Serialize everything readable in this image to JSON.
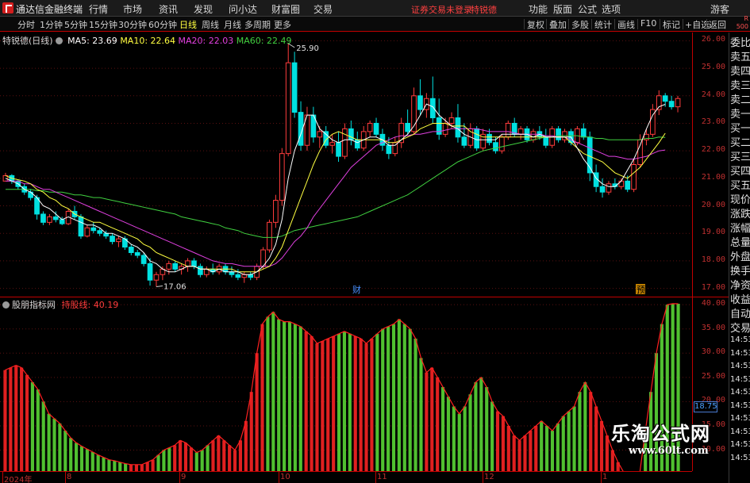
{
  "app": {
    "title": "通达信金融终端"
  },
  "menu": [
    "行情",
    "市场",
    "资讯",
    "发现",
    "问小达",
    "财富圈",
    "交易"
  ],
  "status": {
    "login": "证券交易未登录",
    "stock": "特锐德"
  },
  "right_menu": [
    "功能",
    "版面",
    "公式",
    "选项"
  ],
  "guest": "游客",
  "periods": [
    "分时",
    "1分钟",
    "5分钟",
    "15分钟",
    "30分钟",
    "60分钟",
    "日线",
    "周线",
    "月线",
    "多周期",
    "更多"
  ],
  "active_period": "日线",
  "toolbar_right": [
    "复权",
    "叠加",
    "多股",
    "统计",
    "画线",
    "F10",
    "标记",
    "+自选",
    "返回"
  ],
  "rs_badge": {
    "top": "R",
    "bottom": "500"
  },
  "stock_label": "特锐德(日线)",
  "ma": [
    {
      "label": "MA5: 23.69",
      "color": "#ffffff"
    },
    {
      "label": "MA10: 22.64",
      "color": "#ffff40"
    },
    {
      "label": "MA20: 22.03",
      "color": "#e040e0"
    },
    {
      "label": "MA60: 22.49",
      "color": "#40d040"
    }
  ],
  "price_axis": [
    "26.00",
    "25.00",
    "24.00",
    "23.00",
    "22.00",
    "21.00",
    "20.00",
    "19.00",
    "18.00",
    "17.00"
  ],
  "annotations": {
    "high": "25.90",
    "low": "17.06",
    "cai": "财",
    "yu": "预"
  },
  "indicator": {
    "name": "股朋指标网",
    "line_name": "持股线",
    "line_value": "40.19",
    "current": "18.75"
  },
  "indicator_axis": [
    "40.00",
    "35.00",
    "30.00",
    "25.00",
    "20.00",
    "15.00",
    "10.00"
  ],
  "dates": [
    "2024年",
    "8",
    "9",
    "10",
    "11",
    "12",
    "1"
  ],
  "side_panel": [
    "委比",
    "卖五",
    "卖四",
    "卖三",
    "卖二",
    "卖一",
    "买一",
    "买二",
    "买三",
    "买四",
    "买五",
    "现价",
    "涨跌",
    "涨幅",
    "总量",
    "外盘",
    "换手",
    "净资",
    "收益",
    "自动",
    "交易"
  ],
  "side_times": [
    "14:53",
    "14:53",
    "14:53",
    "14:53",
    "14:53",
    "14:53",
    "14:53",
    "14:53",
    "14:53",
    "14:53"
  ],
  "watermark": {
    "line1": "乐淘公式网",
    "line2": "www.60lt.com"
  },
  "colors": {
    "up": "#ff3c3c",
    "down": "#00e0e0",
    "ind_up": "#e02020",
    "ind_down": "#50c030",
    "frame": "#c00000"
  },
  "chart_data": {
    "type": "candlestick",
    "price_range": [
      16.7,
      26.3
    ],
    "candles": [
      [
        20.9,
        21.2,
        21.0,
        21.1
      ],
      [
        21.1,
        21.15,
        20.8,
        20.9
      ],
      [
        20.9,
        20.95,
        20.6,
        20.7
      ],
      [
        20.7,
        20.8,
        20.4,
        20.5
      ],
      [
        20.5,
        20.6,
        20.2,
        20.3
      ],
      [
        20.3,
        20.4,
        19.5,
        19.7
      ],
      [
        19.7,
        19.8,
        19.3,
        19.4
      ],
      [
        19.4,
        19.7,
        19.3,
        19.6
      ],
      [
        19.6,
        19.8,
        19.4,
        19.5
      ],
      [
        19.5,
        19.6,
        19.3,
        19.35
      ],
      [
        19.35,
        19.9,
        19.3,
        19.8
      ],
      [
        19.8,
        20.0,
        19.5,
        19.6
      ],
      [
        19.6,
        19.7,
        18.8,
        18.9
      ],
      [
        18.9,
        19.3,
        18.85,
        19.2
      ],
      [
        19.2,
        19.4,
        19.0,
        19.1
      ],
      [
        19.1,
        19.2,
        18.9,
        19.0
      ],
      [
        19.0,
        19.1,
        18.8,
        18.9
      ],
      [
        18.9,
        19.0,
        18.6,
        18.7
      ],
      [
        18.7,
        18.9,
        18.5,
        18.8
      ],
      [
        18.8,
        18.9,
        18.4,
        18.5
      ],
      [
        18.5,
        18.6,
        18.2,
        18.3
      ],
      [
        18.3,
        18.4,
        18.1,
        18.2
      ],
      [
        18.2,
        18.3,
        17.8,
        17.9
      ],
      [
        17.9,
        18.1,
        17.1,
        17.3
      ],
      [
        17.3,
        17.6,
        17.06,
        17.5
      ],
      [
        17.5,
        17.8,
        17.3,
        17.7
      ],
      [
        17.7,
        18.0,
        17.5,
        17.9
      ],
      [
        17.9,
        18.0,
        17.6,
        17.7
      ],
      [
        17.7,
        17.9,
        17.5,
        17.8
      ],
      [
        17.8,
        18.1,
        17.6,
        18.0
      ],
      [
        18.0,
        18.1,
        17.7,
        17.8
      ],
      [
        17.8,
        17.9,
        17.4,
        17.5
      ],
      [
        17.5,
        17.8,
        17.4,
        17.7
      ],
      [
        17.7,
        17.9,
        17.5,
        17.6
      ],
      [
        17.6,
        17.9,
        17.5,
        17.8
      ],
      [
        17.8,
        17.9,
        17.5,
        17.6
      ],
      [
        17.6,
        17.8,
        17.4,
        17.5
      ],
      [
        17.5,
        17.7,
        17.3,
        17.4
      ],
      [
        17.4,
        17.6,
        17.2,
        17.5
      ],
      [
        17.5,
        17.6,
        17.3,
        17.4
      ],
      [
        17.4,
        17.9,
        17.3,
        17.8
      ],
      [
        17.8,
        18.5,
        17.7,
        18.4
      ],
      [
        18.4,
        19.5,
        18.3,
        19.4
      ],
      [
        19.4,
        20.4,
        19.2,
        20.2
      ],
      [
        20.2,
        22.1,
        20.0,
        21.9
      ],
      [
        21.9,
        25.9,
        21.8,
        25.2
      ],
      [
        25.2,
        25.6,
        23.2,
        23.4
      ],
      [
        23.4,
        23.8,
        22.0,
        22.2
      ],
      [
        22.2,
        23.6,
        22.0,
        23.3
      ],
      [
        23.3,
        23.6,
        22.3,
        22.5
      ],
      [
        22.5,
        22.9,
        22.1,
        22.7
      ],
      [
        22.7,
        22.9,
        22.1,
        22.2
      ],
      [
        22.2,
        22.6,
        21.9,
        22.3
      ],
      [
        22.3,
        22.7,
        21.6,
        21.8
      ],
      [
        21.8,
        23.0,
        21.7,
        22.8
      ],
      [
        22.8,
        23.1,
        22.2,
        22.4
      ],
      [
        22.4,
        22.7,
        22.0,
        22.1
      ],
      [
        22.1,
        22.9,
        22.0,
        22.7
      ],
      [
        22.7,
        23.1,
        22.5,
        23.0
      ],
      [
        23.0,
        23.2,
        22.5,
        22.6
      ],
      [
        22.6,
        22.8,
        22.0,
        22.2
      ],
      [
        22.2,
        22.5,
        21.7,
        21.9
      ],
      [
        21.9,
        22.5,
        21.8,
        22.3
      ],
      [
        22.3,
        23.2,
        22.1,
        23.0
      ],
      [
        23.0,
        23.5,
        22.6,
        22.7
      ],
      [
        22.7,
        24.3,
        22.6,
        24.0
      ],
      [
        24.0,
        24.6,
        23.3,
        23.5
      ],
      [
        23.5,
        24.1,
        23.2,
        23.9
      ],
      [
        23.9,
        24.7,
        23.0,
        23.2
      ],
      [
        23.2,
        23.9,
        22.4,
        22.6
      ],
      [
        22.6,
        23.2,
        22.5,
        23.0
      ],
      [
        23.0,
        23.4,
        22.8,
        23.2
      ],
      [
        23.2,
        23.7,
        22.3,
        22.5
      ],
      [
        22.5,
        23.0,
        22.1,
        22.2
      ],
      [
        22.2,
        23.0,
        22.1,
        22.8
      ],
      [
        22.8,
        22.9,
        22.0,
        22.1
      ],
      [
        22.1,
        22.8,
        22.0,
        22.6
      ],
      [
        22.6,
        22.8,
        22.2,
        22.3
      ],
      [
        22.3,
        22.5,
        21.9,
        22.0
      ],
      [
        22.0,
        22.6,
        21.9,
        22.5
      ],
      [
        22.5,
        23.1,
        22.4,
        23.0
      ],
      [
        23.0,
        23.2,
        22.5,
        22.6
      ],
      [
        22.6,
        22.9,
        22.4,
        22.8
      ],
      [
        22.8,
        22.9,
        22.3,
        22.4
      ],
      [
        22.4,
        22.8,
        22.3,
        22.7
      ],
      [
        22.7,
        22.9,
        22.4,
        22.5
      ],
      [
        22.5,
        22.8,
        22.1,
        22.2
      ],
      [
        22.2,
        22.9,
        22.1,
        22.8
      ],
      [
        22.8,
        22.9,
        22.3,
        22.4
      ],
      [
        22.4,
        22.8,
        22.3,
        22.7
      ],
      [
        22.7,
        22.8,
        22.2,
        22.3
      ],
      [
        22.3,
        22.9,
        22.2,
        22.8
      ],
      [
        22.8,
        23.0,
        22.4,
        22.5
      ],
      [
        22.5,
        22.7,
        20.9,
        21.2
      ],
      [
        21.2,
        21.5,
        20.5,
        20.7
      ],
      [
        20.7,
        21.0,
        20.3,
        20.5
      ],
      [
        20.5,
        20.9,
        20.4,
        20.8
      ],
      [
        20.8,
        21.0,
        20.6,
        20.7
      ],
      [
        20.7,
        21.0,
        20.6,
        20.9
      ],
      [
        20.9,
        21.1,
        20.5,
        20.6
      ],
      [
        20.6,
        21.7,
        20.5,
        21.5
      ],
      [
        21.5,
        22.6,
        21.4,
        22.4
      ],
      [
        22.4,
        22.8,
        22.2,
        22.6
      ],
      [
        22.6,
        23.7,
        22.5,
        23.5
      ],
      [
        23.5,
        24.2,
        23.3,
        24.0
      ],
      [
        24.0,
        24.1,
        23.6,
        23.8
      ],
      [
        23.8,
        24.0,
        23.5,
        23.6
      ],
      [
        23.6,
        24.0,
        23.4,
        23.9
      ]
    ],
    "ma5": [
      21.0,
      20.9,
      20.8,
      20.6,
      20.5,
      20.3,
      20.0,
      19.9,
      19.7,
      19.5,
      19.6,
      19.5,
      19.4,
      19.3,
      19.3,
      19.2,
      19.0,
      19.0,
      18.9,
      18.8,
      18.6,
      18.5,
      18.3,
      18.0,
      17.9,
      17.7,
      17.6,
      17.6,
      17.7,
      17.8,
      17.8,
      17.7,
      17.7,
      17.6,
      17.7,
      17.6,
      17.6,
      17.6,
      17.5,
      17.5,
      17.6,
      17.8,
      18.1,
      18.6,
      19.5,
      21.0,
      22.0,
      22.6,
      23.3,
      23.3,
      22.8,
      22.6,
      22.4,
      22.3,
      22.4,
      22.4,
      22.3,
      22.4,
      22.5,
      22.5,
      22.4,
      22.2,
      22.2,
      22.4,
      22.6,
      22.9,
      23.3,
      23.7,
      23.6,
      23.3,
      23.1,
      22.9,
      22.8,
      22.6,
      22.5,
      22.4,
      22.4,
      22.4,
      22.4,
      22.6,
      22.6,
      22.6,
      22.6,
      22.6,
      22.5,
      22.6,
      22.5,
      22.5,
      22.5,
      22.5,
      22.5,
      22.1,
      21.7,
      21.4,
      21.0,
      20.8,
      20.7,
      20.7,
      20.9,
      21.3,
      21.7,
      22.2,
      22.8,
      23.3,
      23.6,
      23.69
    ],
    "ma10": [
      21.1,
      21.0,
      20.95,
      20.9,
      20.8,
      20.6,
      20.5,
      20.3,
      20.2,
      20.0,
      19.9,
      19.7,
      19.6,
      19.5,
      19.4,
      19.4,
      19.3,
      19.2,
      19.1,
      19.0,
      18.9,
      18.8,
      18.6,
      18.5,
      18.3,
      18.2,
      18.1,
      18.0,
      17.9,
      17.8,
      17.8,
      17.7,
      17.7,
      17.7,
      17.7,
      17.7,
      17.7,
      17.6,
      17.6,
      17.6,
      17.6,
      17.7,
      17.8,
      18.1,
      18.5,
      19.1,
      19.7,
      20.3,
      20.9,
      21.5,
      22.0,
      22.4,
      22.6,
      22.7,
      22.6,
      22.5,
      22.4,
      22.4,
      22.4,
      22.4,
      22.4,
      22.3,
      22.3,
      22.4,
      22.5,
      22.6,
      22.8,
      22.9,
      23.0,
      23.0,
      23.0,
      22.9,
      22.9,
      22.9,
      22.7,
      22.6,
      22.5,
      22.5,
      22.5,
      22.5,
      22.5,
      22.5,
      22.5,
      22.5,
      22.5,
      22.5,
      22.5,
      22.5,
      22.5,
      22.5,
      22.3,
      22.1,
      21.9,
      21.8,
      21.7,
      21.6,
      21.4,
      21.2,
      21.1,
      21.0,
      21.2,
      21.4,
      21.7,
      22.0,
      22.3,
      22.64
    ],
    "ma20": [
      20.9,
      20.9,
      20.9,
      20.8,
      20.8,
      20.7,
      20.6,
      20.6,
      20.5,
      20.4,
      20.3,
      20.2,
      20.1,
      20.0,
      19.9,
      19.8,
      19.7,
      19.6,
      19.5,
      19.4,
      19.3,
      19.2,
      19.1,
      19.0,
      18.9,
      18.8,
      18.7,
      18.6,
      18.5,
      18.4,
      18.3,
      18.2,
      18.1,
      18.0,
      17.95,
      17.9,
      17.9,
      17.85,
      17.8,
      17.8,
      17.8,
      17.8,
      17.8,
      17.9,
      18.1,
      18.4,
      18.7,
      18.9,
      19.2,
      19.6,
      19.9,
      20.2,
      20.5,
      20.8,
      21.1,
      21.4,
      21.6,
      21.8,
      22.0,
      22.2,
      22.3,
      22.4,
      22.5,
      22.55,
      22.55,
      22.6,
      22.6,
      22.65,
      22.7,
      22.7,
      22.75,
      22.8,
      22.8,
      22.8,
      22.8,
      22.8,
      22.75,
      22.7,
      22.7,
      22.7,
      22.7,
      22.65,
      22.6,
      22.6,
      22.6,
      22.6,
      22.55,
      22.55,
      22.5,
      22.5,
      22.4,
      22.3,
      22.2,
      22.1,
      22.0,
      21.9,
      21.8,
      21.8,
      21.75,
      21.7,
      21.7,
      21.75,
      21.8,
      21.9,
      22.0,
      22.03
    ],
    "ma60": [
      20.6,
      20.6,
      20.6,
      20.6,
      20.6,
      20.55,
      20.55,
      20.5,
      20.5,
      20.5,
      20.45,
      20.4,
      20.4,
      20.35,
      20.3,
      20.3,
      20.25,
      20.2,
      20.15,
      20.1,
      20.05,
      20.0,
      19.95,
      19.9,
      19.85,
      19.8,
      19.75,
      19.7,
      19.6,
      19.55,
      19.5,
      19.45,
      19.4,
      19.35,
      19.3,
      19.2,
      19.15,
      19.1,
      19.0,
      18.95,
      18.9,
      18.85,
      18.85,
      18.85,
      18.9,
      19.0,
      19.1,
      19.15,
      19.2,
      19.25,
      19.3,
      19.35,
      19.4,
      19.45,
      19.5,
      19.55,
      19.6,
      19.7,
      19.8,
      19.9,
      20.0,
      20.1,
      20.2,
      20.3,
      20.4,
      20.55,
      20.7,
      20.85,
      21.0,
      21.15,
      21.3,
      21.45,
      21.6,
      21.7,
      21.8,
      21.9,
      22.0,
      22.05,
      22.1,
      22.15,
      22.2,
      22.25,
      22.3,
      22.35,
      22.4,
      22.45,
      22.5,
      22.5,
      22.55,
      22.55,
      22.55,
      22.55,
      22.5,
      22.5,
      22.45,
      22.45,
      22.4,
      22.4,
      22.4,
      22.4,
      22.4,
      22.4,
      22.45,
      22.45,
      22.5,
      22.49
    ],
    "indicator_range": [
      5.5,
      41.5
    ],
    "indicator_values": [
      26.5,
      27.0,
      27.5,
      27.0,
      25.5,
      24.0,
      22.5,
      20.0,
      17.5,
      16.5,
      15.5,
      14.0,
      12.5,
      11.5,
      10.8,
      10.2,
      9.6,
      9.0,
      8.5,
      8.0,
      7.8,
      7.5,
      7.2,
      7.0,
      7.0,
      7.0,
      7.5,
      8.0,
      9.0,
      10.0,
      10.5,
      11.0,
      12.0,
      11.5,
      10.5,
      9.5,
      10.0,
      11.0,
      12.0,
      13.0,
      12.0,
      11.0,
      10.0,
      12.0,
      16.0,
      22.0,
      30.0,
      36.0,
      37.5,
      38.5,
      37.0,
      36.5,
      36.5,
      36.0,
      35.5,
      34.5,
      33.5,
      32.0,
      32.5,
      33.0,
      33.5,
      34.0,
      34.5,
      34.0,
      33.5,
      33.0,
      32.0,
      33.0,
      34.0,
      35.0,
      35.5,
      36.0,
      37.0,
      36.0,
      35.0,
      33.0,
      29.0,
      26.0,
      27.0,
      25.0,
      23.0,
      21.0,
      19.0,
      17.5,
      19.0,
      21.5,
      24.0,
      25.0,
      23.0,
      20.0,
      18.0,
      17.0,
      15.0,
      13.0,
      12.0,
      13.0,
      14.0,
      15.0,
      16.0,
      15.0,
      14.0,
      15.5,
      17.0,
      18.0,
      19.0,
      22.0,
      24.0,
      22.0,
      19.0,
      16.0,
      13.0,
      10.0,
      7.5,
      5.5,
      5.5,
      5.5,
      5.5,
      14.0,
      22.0,
      30.0,
      36.0,
      40.0,
      40.2,
      40.19
    ],
    "indicator_colors": "rrrrrggggggggggggggggggrrrrrgggrrrrgggrrrrrrrrrrgggggggrrrrrrgggrrrrgggggggggrrrggggggggggrrrrrrrrgggggggggrrrrrrg"
  }
}
